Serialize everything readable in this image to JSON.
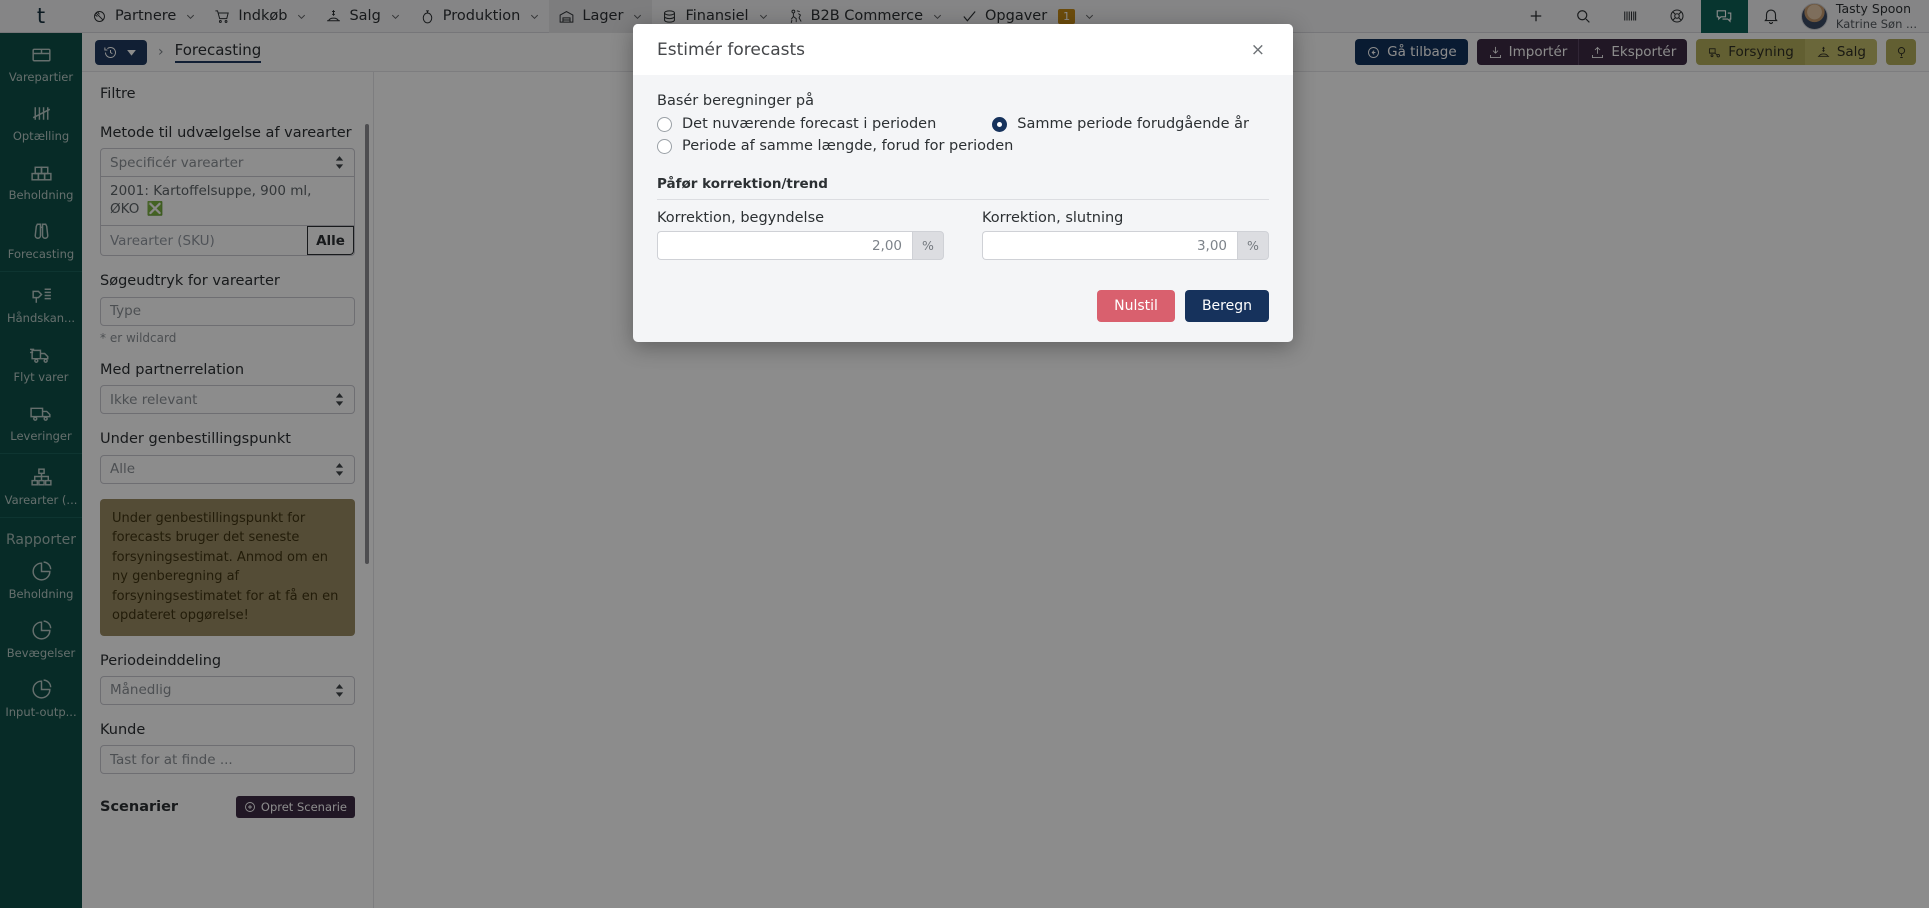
{
  "topnav": {
    "brand": "t",
    "items": [
      {
        "label": "Partnere",
        "icon": "partners-icon",
        "caret": true,
        "active": false
      },
      {
        "label": "Indkøb",
        "icon": "cart-icon",
        "caret": true,
        "active": false
      },
      {
        "label": "Salg",
        "icon": "sales-icon",
        "caret": true,
        "active": false
      },
      {
        "label": "Produktion",
        "icon": "production-icon",
        "caret": true,
        "active": false
      },
      {
        "label": "Lager",
        "icon": "warehouse-icon",
        "caret": true,
        "active": true
      },
      {
        "label": "Finansiel",
        "icon": "finance-icon",
        "caret": true,
        "active": false
      },
      {
        "label": "B2B Commerce",
        "icon": "b2b-icon",
        "caret": true,
        "active": false
      },
      {
        "label": "Opgaver",
        "icon": "check-icon",
        "caret": true,
        "active": false,
        "badge": "1"
      }
    ],
    "right_icons": [
      "plus-icon",
      "search-icon",
      "barcode-icon",
      "lifebuoy-icon",
      "chat-icon",
      "bell-icon"
    ],
    "user": {
      "company": "Tasty Spoon",
      "name": "Katrine Søn ..."
    }
  },
  "rail": {
    "items": [
      {
        "label": "Varepartier",
        "icon": "box-icon"
      },
      {
        "label": "Optælling",
        "icon": "tally-icon"
      },
      {
        "label": "Beholdning",
        "icon": "stock-icon"
      },
      {
        "label": "Forecasting",
        "icon": "binoculars-icon"
      }
    ],
    "items2": [
      {
        "label": "Håndskan...",
        "icon": "handscanner-icon"
      },
      {
        "label": "Flyt varer",
        "icon": "move-goods-icon"
      },
      {
        "label": "Leveringer",
        "icon": "delivery-icon"
      }
    ],
    "items3": [
      {
        "label": "Varearter (...",
        "icon": "hierarchy-icon"
      }
    ],
    "section_title": "Rapporter",
    "items4": [
      {
        "label": "Beholdning",
        "icon": "piechart-icon"
      },
      {
        "label": "Bevægelser",
        "icon": "piechart-icon"
      },
      {
        "label": "Input-outp...",
        "icon": "piechart-icon"
      }
    ]
  },
  "toolbar": {
    "history_label": "",
    "breadcrumb_sep": "›",
    "breadcrumb_current": "Forecasting",
    "buttons": [
      {
        "label": "Gå tilbage",
        "icon": "back-circle-icon",
        "style": "navy"
      },
      {
        "label": "Importér",
        "icon": "import-icon",
        "style": "plum-l"
      },
      {
        "label": "Eksportér",
        "icon": "export-icon",
        "style": "plum-r"
      },
      {
        "label": "Forsyning",
        "icon": "supply-icon",
        "style": "olive-l"
      },
      {
        "label": "Salg",
        "icon": "sales-icon",
        "style": "olive-r"
      },
      {
        "label": "",
        "icon": "help-icon",
        "style": "olive-solo"
      }
    ]
  },
  "filters": {
    "title": "Filtre",
    "method_label": "Metode til udvælgelse af varearter",
    "method_value": "Specificér varearter",
    "chip": "2001: Kartoffelsuppe, 900 ml, ØKO",
    "sku_placeholder": "Varearter (SKU)",
    "sku_all": "Alle",
    "search_label": "Søgeudtryk for varearter",
    "search_placeholder": "Type",
    "wildcard_hint": "* er wildcard",
    "partner_label": "Med partnerrelation",
    "partner_value": "Ikke relevant",
    "reorder_label": "Under genbestillingspunkt",
    "reorder_value": "Alle",
    "note": "Under genbestillingspunkt for forecasts bruger det seneste forsyningsestimat. Anmod om en ny genberegning af forsyningsestimatet for at få en en opdateret opgørelse!",
    "period_label": "Periodeinddeling",
    "period_value": "Månedlig",
    "customer_label": "Kunde",
    "customer_placeholder": "Tast for at finde ...",
    "scenarios_label": "Scenarier",
    "create_scenario": "Opret Scenarie"
  },
  "modal": {
    "title": "Estimér forecasts",
    "close": "×",
    "basis_label": "Basér beregninger på",
    "options": [
      {
        "label": "Det nuværende forecast i perioden",
        "selected": false
      },
      {
        "label": "Samme periode forudgående år",
        "selected": true
      },
      {
        "label": "Periode af samme længde, forud for perioden",
        "selected": false
      }
    ],
    "correction_heading": "Påfør korrektion/trend",
    "start_label": "Korrektion, begyndelse",
    "start_value": "2,00",
    "start_unit": "%",
    "end_label": "Korrektion, slutning",
    "end_value": "3,00",
    "end_unit": "%",
    "reset_label": "Nulstil",
    "calc_label": "Beregn"
  },
  "colors": {
    "brand_teal": "#0d4f47",
    "navy": "#16325c",
    "danger": "#d9606e",
    "olive": "#b3ad5c",
    "plum": "#3d2b44",
    "note_bg": "#9a8a63",
    "badge": "#c58a16"
  }
}
